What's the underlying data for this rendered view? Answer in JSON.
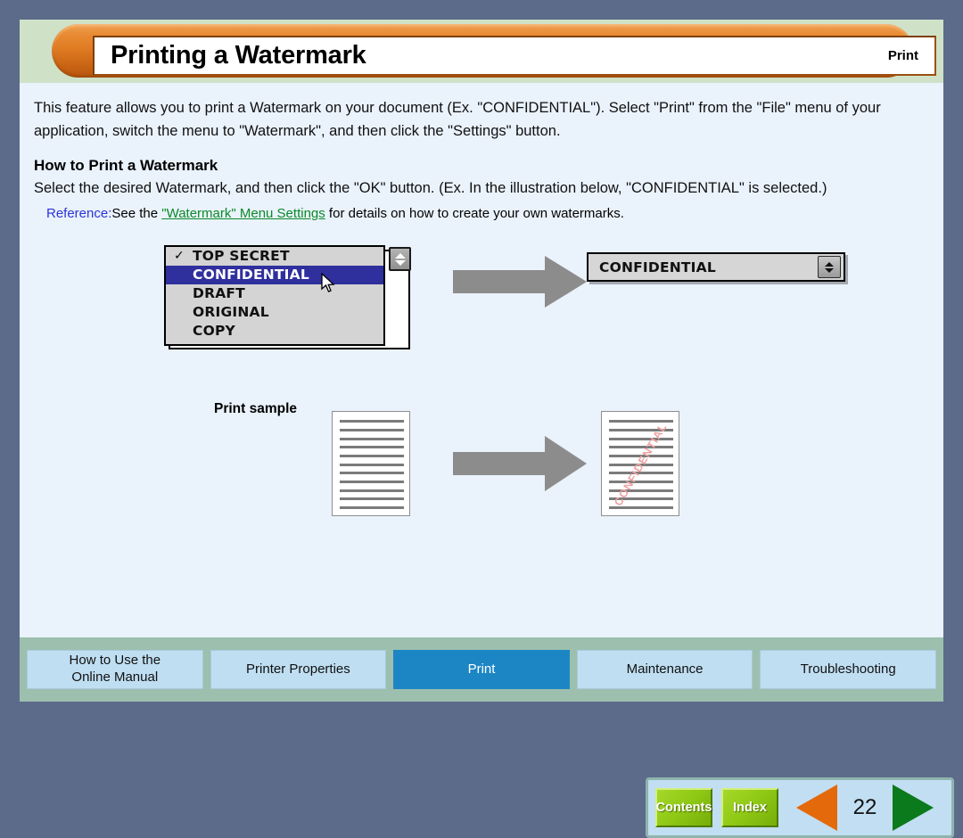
{
  "header": {
    "title": "Printing a Watermark",
    "section": "Print"
  },
  "body": {
    "intro": "This feature allows you to print a Watermark on your document (Ex. \"CONFIDENTIAL\"). Select \"Print\" from the \"File\" menu of your application, switch the menu to \"Watermark\", and then click the \"Settings\" button.",
    "subheading": "How to Print a Watermark",
    "instruction": "Select the desired Watermark, and then click the \"OK\" button. (Ex. In the illustration below, \"CONFIDENTIAL\" is selected.)",
    "reference_label": "Reference:",
    "reference_prefix": "See the ",
    "reference_link": "\"Watermark\" Menu Settings",
    "reference_suffix": " for details on how to create your own watermarks."
  },
  "illustration": {
    "watermark_list": [
      {
        "label": "TOP SECRET",
        "checked": true,
        "selected": false
      },
      {
        "label": "CONFIDENTIAL",
        "checked": false,
        "selected": true
      },
      {
        "label": "DRAFT",
        "checked": false,
        "selected": false
      },
      {
        "label": "ORIGINAL",
        "checked": false,
        "selected": false
      },
      {
        "label": "COPY",
        "checked": false,
        "selected": false
      }
    ],
    "check_glyph": "✓",
    "combo_value": "CONFIDENTIAL",
    "print_sample_label": "Print sample",
    "watermark_text": "CONFIDENTIAL",
    "arrow_color": "#8c8c8c"
  },
  "nav": {
    "contents_label": "Contents",
    "index_label": "Index",
    "page_number": "22",
    "prev_color": "#e4690b",
    "next_color": "#0a7a1c"
  },
  "tabs": [
    {
      "label": "How to Use the\nOnline Manual",
      "line1": "How to Use the",
      "line2": "Online Manual",
      "active": false
    },
    {
      "label": "Printer Properties",
      "line1": "Printer Properties",
      "line2": "",
      "active": false
    },
    {
      "label": "Print",
      "line1": "Print",
      "line2": "",
      "active": true
    },
    {
      "label": "Maintenance",
      "line1": "Maintenance",
      "line2": "",
      "active": false
    },
    {
      "label": "Troubleshooting",
      "line1": "Troubleshooting",
      "line2": "",
      "active": false
    }
  ],
  "colors": {
    "outer_bg": "#5c6b8a",
    "content_bg": "#eaf2fb",
    "header_bg": "#cfe2c8",
    "tabbar_bg": "#9dbfae",
    "accent_orange": "#e07c22",
    "active_tab": "#1c86c4"
  }
}
